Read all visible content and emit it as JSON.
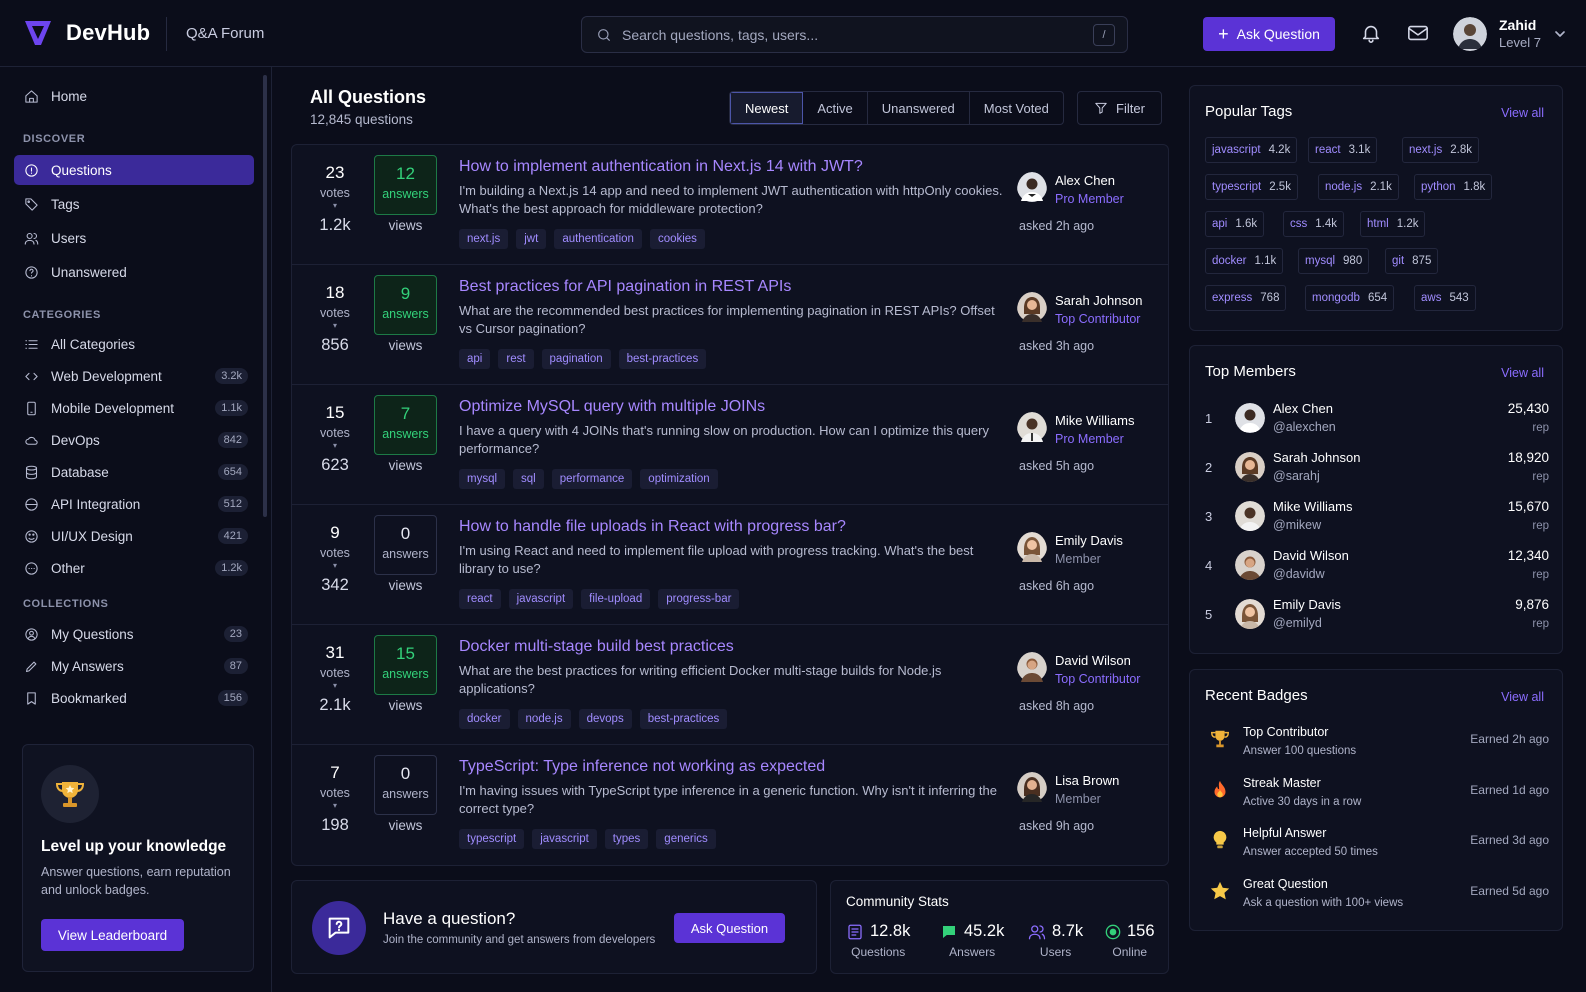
{
  "header": {
    "brand": "DevHub",
    "section": "Q&A Forum",
    "search_placeholder": "Search questions, tags, users...",
    "search_shortcut": "/",
    "ask_label": "Ask Question",
    "user": {
      "name": "Zahid",
      "level": "Level 7"
    }
  },
  "sidebar": {
    "home": "Home",
    "discover_title": "DISCOVER",
    "discover": [
      {
        "label": "Questions",
        "icon": "question-circle-icon"
      },
      {
        "label": "Tags",
        "icon": "tag-icon"
      },
      {
        "label": "Users",
        "icon": "users-icon"
      },
      {
        "label": "Unanswered",
        "icon": "help-circle-icon"
      }
    ],
    "categories_title": "CATEGORIES",
    "categories": [
      {
        "label": "All Categories",
        "count": ""
      },
      {
        "label": "Web Development",
        "count": "3.2k"
      },
      {
        "label": "Mobile Development",
        "count": "1.1k"
      },
      {
        "label": "DevOps",
        "count": "842"
      },
      {
        "label": "Database",
        "count": "654"
      },
      {
        "label": "API Integration",
        "count": "512"
      },
      {
        "label": "UI/UX Design",
        "count": "421"
      },
      {
        "label": "Other",
        "count": "1.2k"
      }
    ],
    "collections_title": "COLLECTIONS",
    "collections": [
      {
        "label": "My Questions",
        "count": "23"
      },
      {
        "label": "My Answers",
        "count": "87"
      },
      {
        "label": "Bookmarked",
        "count": "156"
      }
    ],
    "promo": {
      "title": "Level up your knowledge",
      "text": "Answer questions, earn reputation and unlock badges.",
      "button": "View Leaderboard"
    }
  },
  "main": {
    "title": "All Questions",
    "subtitle": "12,845 questions",
    "tabs": [
      "Newest",
      "Active",
      "Unanswered",
      "Most Voted"
    ],
    "active_tab": "Newest",
    "filter_label": "Filter",
    "labels": {
      "votes": "votes",
      "answers": "answers",
      "views": "views"
    },
    "questions": [
      {
        "votes": "23",
        "answers": "12",
        "views": "1.2k",
        "title": "How to implement authentication in Next.js 14 with JWT?",
        "body": "I'm building a Next.js 14 app and need to implement JWT authentication with httpOnly cookies. What's the best approach for middleware protection?",
        "tags": [
          "next.js",
          "jwt",
          "authentication",
          "cookies"
        ],
        "author": "Alex Chen",
        "rank": "Pro Member",
        "asked": "asked 2h ago"
      },
      {
        "votes": "18",
        "answers": "9",
        "views": "856",
        "title": "Best practices for API pagination in REST APIs",
        "body": "What are the recommended best practices for implementing pagination in REST APIs? Offset vs Cursor pagination?",
        "tags": [
          "api",
          "rest",
          "pagination",
          "best-practices"
        ],
        "author": "Sarah Johnson",
        "rank": "Top Contributor",
        "asked": "asked 3h ago"
      },
      {
        "votes": "15",
        "answers": "7",
        "views": "623",
        "title": "Optimize MySQL query with multiple JOINs",
        "body": "I have a query with 4 JOINs that's running slow on production. How can I optimize this query performance?",
        "tags": [
          "mysql",
          "sql",
          "performance",
          "optimization"
        ],
        "author": "Mike Williams",
        "rank": "Pro Member",
        "asked": "asked 5h ago"
      },
      {
        "votes": "9",
        "answers": "0",
        "views": "342",
        "title": "How to handle file uploads in React with progress bar?",
        "body": "I'm using React and need to implement file upload with progress tracking. What's the best library to use?",
        "tags": [
          "react",
          "javascript",
          "file-upload",
          "progress-bar"
        ],
        "author": "Emily Davis",
        "rank": "Member",
        "asked": "asked 6h ago"
      },
      {
        "votes": "31",
        "answers": "15",
        "views": "2.1k",
        "title": "Docker multi-stage build best practices",
        "body": "What are the best practices for writing efficient Docker multi-stage builds for Node.js applications?",
        "tags": [
          "docker",
          "node.js",
          "devops",
          "best-practices"
        ],
        "author": "David Wilson",
        "rank": "Top Contributor",
        "asked": "asked 8h ago"
      },
      {
        "votes": "7",
        "answers": "0",
        "views": "198",
        "title": "TypeScript: Type inference not working as expected",
        "body": "I'm having issues with TypeScript type inference in a generic function. Why isn't it inferring the correct type?",
        "tags": [
          "typescript",
          "javascript",
          "types",
          "generics"
        ],
        "author": "Lisa Brown",
        "rank": "Member",
        "asked": "asked 9h ago"
      }
    ],
    "cta": {
      "title": "Have a question?",
      "text": "Join the community and get answers from developers",
      "button": "Ask Question"
    },
    "community": {
      "title": "Community Stats",
      "stats": [
        {
          "value": "12.8k",
          "label": "Questions"
        },
        {
          "value": "45.2k",
          "label": "Answers"
        },
        {
          "value": "8.7k",
          "label": "Users"
        },
        {
          "value": "156",
          "label": "Online"
        }
      ]
    }
  },
  "right": {
    "view_all": "View all",
    "popular_tags_title": "Popular Tags",
    "popular_tags": [
      {
        "name": "javascript",
        "count": "4.2k"
      },
      {
        "name": "react",
        "count": "3.1k"
      },
      {
        "name": "next.js",
        "count": "2.8k"
      },
      {
        "name": "typescript",
        "count": "2.5k"
      },
      {
        "name": "node.js",
        "count": "2.1k"
      },
      {
        "name": "python",
        "count": "1.8k"
      },
      {
        "name": "api",
        "count": "1.6k"
      },
      {
        "name": "css",
        "count": "1.4k"
      },
      {
        "name": "html",
        "count": "1.2k"
      },
      {
        "name": "docker",
        "count": "1.1k"
      },
      {
        "name": "mysql",
        "count": "980"
      },
      {
        "name": "git",
        "count": "875"
      },
      {
        "name": "express",
        "count": "768"
      },
      {
        "name": "mongodb",
        "count": "654"
      },
      {
        "name": "aws",
        "count": "543"
      }
    ],
    "top_members_title": "Top Members",
    "top_members": [
      {
        "rank": "1",
        "name": "Alex Chen",
        "handle": "@alexchen",
        "rep": "25,430"
      },
      {
        "rank": "2",
        "name": "Sarah Johnson",
        "handle": "@sarahj",
        "rep": "18,920"
      },
      {
        "rank": "3",
        "name": "Mike Williams",
        "handle": "@mikew",
        "rep": "15,670"
      },
      {
        "rank": "4",
        "name": "David Wilson",
        "handle": "@davidw",
        "rep": "12,340"
      },
      {
        "rank": "5",
        "name": "Emily Davis",
        "handle": "@emilyd",
        "rep": "9,876"
      }
    ],
    "rep_label": "rep",
    "badges_title": "Recent Badges",
    "badges": [
      {
        "name": "Top Contributor",
        "desc": "Answer 100 questions",
        "earned": "Earned  2h ago",
        "icon": "trophy-icon"
      },
      {
        "name": "Streak Master",
        "desc": "Active 30 days in a row",
        "earned": "Earned  1d ago",
        "icon": "fire-icon"
      },
      {
        "name": "Helpful Answer",
        "desc": "Answer accepted 50 times",
        "earned": "Earned  3d ago",
        "icon": "lightbulb-icon"
      },
      {
        "name": "Great Question",
        "desc": "Ask a question with 100+ views",
        "earned": "Earned  5d ago",
        "icon": "star-icon"
      }
    ]
  },
  "colors": {
    "accent": "#5b33d6",
    "link": "#a787ff",
    "success": "#33d17a",
    "bg": "#0b0d1a"
  }
}
